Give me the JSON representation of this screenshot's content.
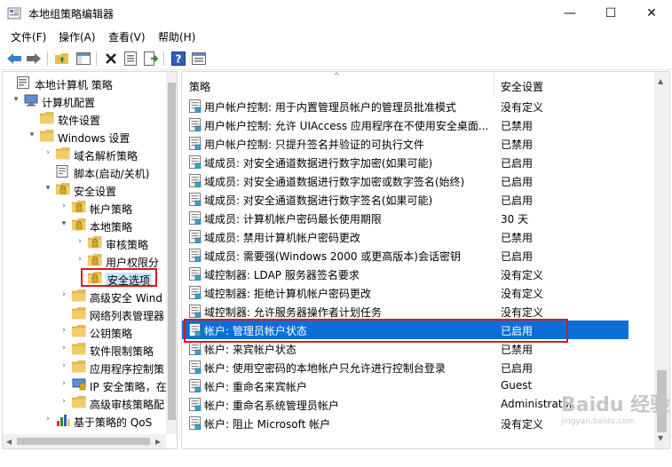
{
  "window": {
    "title": "本地组策略编辑器",
    "minimize": "—",
    "maximize": "☐",
    "close": "✕"
  },
  "menu": [
    {
      "label": "文件(F)"
    },
    {
      "label": "操作(A)"
    },
    {
      "label": "查看(V)"
    },
    {
      "label": "帮助(H)"
    }
  ],
  "tree": [
    {
      "label": "本地计算机 策略",
      "expanded": null,
      "icon": "computer-policy-icon"
    },
    {
      "label": "计算机配置",
      "expanded": true,
      "icon": "computer-icon"
    },
    {
      "label": "软件设置",
      "expanded": null,
      "icon": "folder-icon"
    },
    {
      "label": "Windows 设置",
      "expanded": true,
      "icon": "folder-icon"
    },
    {
      "label": "域名解析策略",
      "expanded": false,
      "icon": "folder-icon"
    },
    {
      "label": "脚本(启动/关机)",
      "expanded": null,
      "icon": "script-icon"
    },
    {
      "label": "安全设置",
      "expanded": true,
      "icon": "security-folder-icon"
    },
    {
      "label": "帐户策略",
      "expanded": false,
      "icon": "security-folder-icon"
    },
    {
      "label": "本地策略",
      "expanded": true,
      "icon": "security-folder-icon"
    },
    {
      "label": "审核策略",
      "expanded": false,
      "icon": "security-folder-icon"
    },
    {
      "label": "用户权限分",
      "expanded": false,
      "icon": "security-folder-icon"
    },
    {
      "label": "安全选项",
      "expanded": null,
      "icon": "security-folder-icon",
      "selected": true
    },
    {
      "label": "高级安全 Wind",
      "expanded": false,
      "icon": "folder-icon"
    },
    {
      "label": "网络列表管理器",
      "expanded": null,
      "icon": "folder-icon"
    },
    {
      "label": "公钥策略",
      "expanded": false,
      "icon": "folder-icon"
    },
    {
      "label": "软件限制策略",
      "expanded": false,
      "icon": "folder-icon"
    },
    {
      "label": "应用程序控制策",
      "expanded": false,
      "icon": "folder-icon"
    },
    {
      "label": "IP 安全策略，在",
      "expanded": false,
      "icon": "ip-security-icon"
    },
    {
      "label": "高级审核策略配",
      "expanded": false,
      "icon": "folder-icon"
    },
    {
      "label": "基于策略的 QoS",
      "expanded": false,
      "icon": "chart-icon"
    }
  ],
  "list": {
    "columns": {
      "policy": "策略",
      "setting": "安全设置"
    },
    "rows": [
      {
        "policy": "用户帐户控制: 用于内置管理员帐户的管理员批准模式",
        "setting": "没有定义"
      },
      {
        "policy": "用户帐户控制: 允许 UIAccess 应用程序在不使用安全桌面...",
        "setting": "已禁用"
      },
      {
        "policy": "用户帐户控制: 只提升签名并验证的可执行文件",
        "setting": "已禁用"
      },
      {
        "policy": "域成员: 对安全通道数据进行数字加密(如果可能)",
        "setting": "已启用"
      },
      {
        "policy": "域成员: 对安全通道数据进行数字加密或数字签名(始终)",
        "setting": "已启用"
      },
      {
        "policy": "域成员: 对安全通道数据进行数字签名(如果可能)",
        "setting": "已启用"
      },
      {
        "policy": "域成员: 计算机帐户密码最长使用期限",
        "setting": "30 天"
      },
      {
        "policy": "域成员: 禁用计算机帐户密码更改",
        "setting": "已禁用"
      },
      {
        "policy": "域成员: 需要强(Windows 2000 或更高版本)会话密钥",
        "setting": "已启用"
      },
      {
        "policy": "域控制器: LDAP 服务器签名要求",
        "setting": "没有定义"
      },
      {
        "policy": "域控制器: 拒绝计算机帐户密码更改",
        "setting": "没有定义"
      },
      {
        "policy": "域控制器: 允许服务器操作者计划任务",
        "setting": "没有定义"
      },
      {
        "policy": "帐户: 管理员帐户状态",
        "setting": "已启用",
        "selected": true
      },
      {
        "policy": "帐户: 来宾帐户状态",
        "setting": "已禁用"
      },
      {
        "policy": "帐户: 使用空密码的本地帐户只允许进行控制台登录",
        "setting": "已启用"
      },
      {
        "policy": "帐户: 重命名来宾帐户",
        "setting": "Guest"
      },
      {
        "policy": "帐户: 重命名系统管理员帐户",
        "setting": "Administrator"
      },
      {
        "policy": "帐户: 阻止 Microsoft 帐户",
        "setting": "没有定义"
      }
    ]
  },
  "watermark": {
    "line1": "Baidu 经验",
    "line2": "jingyan.baidu.com"
  },
  "colors": {
    "selection": "#0a6fd6",
    "highlight_box": "#d9191f"
  }
}
